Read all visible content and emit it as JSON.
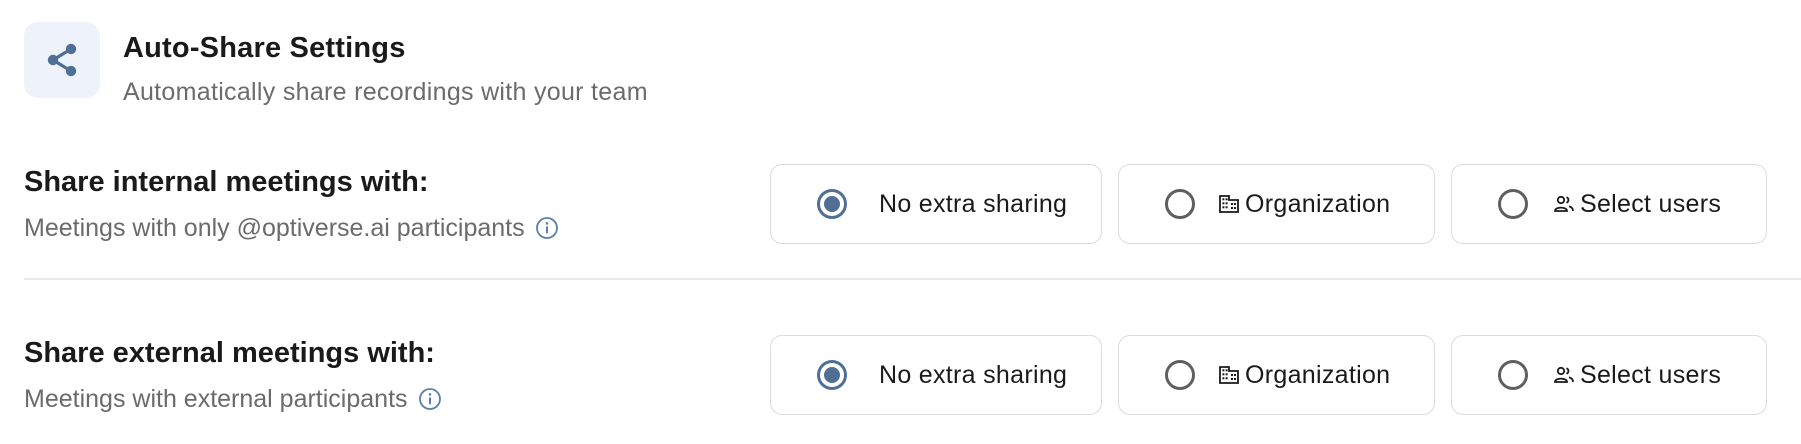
{
  "header": {
    "icon": "share-icon",
    "title": "Auto-Share Settings",
    "subtitle": "Automatically share recordings with your team"
  },
  "colors": {
    "accent": "#4f6f95",
    "icon_bg": "#eef3fb",
    "border": "#dcdcdc",
    "muted_text": "#6b6b6b"
  },
  "internal": {
    "title": "Share internal meetings with:",
    "description": "Meetings with only @optiverse.ai participants",
    "info_icon": "info-icon",
    "selected": "No extra sharing",
    "options": [
      {
        "label": "No extra sharing",
        "icon": "",
        "checked": true
      },
      {
        "label": "Organization",
        "icon": "building-icon",
        "checked": false
      },
      {
        "label": "Select users",
        "icon": "users-icon",
        "checked": false
      }
    ]
  },
  "external": {
    "title": "Share external meetings with:",
    "description": "Meetings with external participants",
    "info_icon": "info-icon",
    "selected": "No extra sharing",
    "options": [
      {
        "label": "No extra sharing",
        "icon": "",
        "checked": true
      },
      {
        "label": "Organization",
        "icon": "building-icon",
        "checked": false
      },
      {
        "label": "Select users",
        "icon": "users-icon",
        "checked": false
      }
    ]
  }
}
